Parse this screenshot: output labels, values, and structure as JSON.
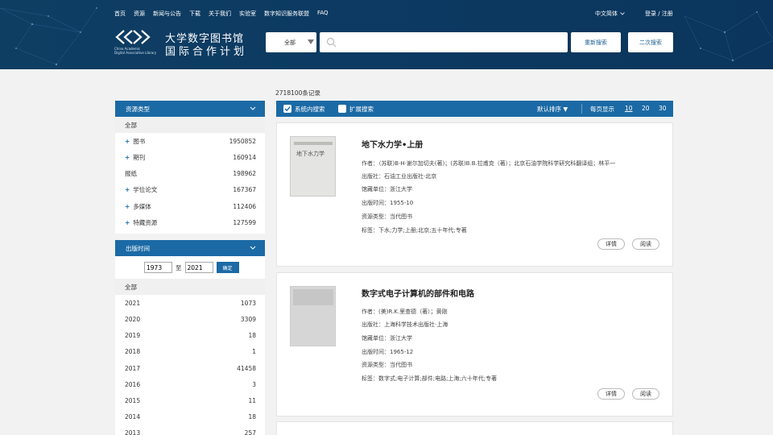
{
  "nav": [
    "首页",
    "资源",
    "新闻与公告",
    "下载",
    "关于我们",
    "实验室",
    "数字知识服务联盟",
    "FAQ"
  ],
  "lang": "中文简体",
  "login": "登录 / 注册",
  "logo": {
    "sub1": "China Academic",
    "sub2": "Digital Associative Library",
    "title1": "大学数字图书馆",
    "title2": "国际合作计划"
  },
  "search": {
    "scope": "全部",
    "placeholder": "",
    "research": "重新搜索",
    "second": "二次搜索"
  },
  "count": "2718100条记录",
  "resource": {
    "header": "资源类型",
    "all": "全部",
    "items": [
      {
        "plus": true,
        "label": "图书",
        "count": "1950852"
      },
      {
        "plus": true,
        "label": "期刊",
        "count": "160914"
      },
      {
        "plus": false,
        "label": "报纸",
        "count": "198962"
      },
      {
        "plus": true,
        "label": "学位论文",
        "count": "167367"
      },
      {
        "plus": true,
        "label": "多媒体",
        "count": "112406"
      },
      {
        "plus": true,
        "label": "特藏资源",
        "count": "127599"
      }
    ]
  },
  "pubtime": {
    "header": "出版时间",
    "from": "1973",
    "to_label": "至",
    "to": "2021",
    "ok": "确定",
    "all": "全部",
    "items": [
      {
        "label": "2021",
        "count": "1073"
      },
      {
        "label": "2020",
        "count": "3309"
      },
      {
        "label": "2019",
        "count": "18"
      },
      {
        "label": "2018",
        "count": "1"
      },
      {
        "label": "2017",
        "count": "41458"
      },
      {
        "label": "2016",
        "count": "3"
      },
      {
        "label": "2015",
        "count": "11"
      },
      {
        "label": "2014",
        "count": "18"
      },
      {
        "label": "2013",
        "count": "257"
      }
    ]
  },
  "toolbar": {
    "inside": "系统内搜索",
    "extend": "扩展搜索",
    "sort": "默认排序",
    "per_page_label": "每页显示",
    "per_page": [
      "10",
      "20",
      "30"
    ],
    "inside_checked": true,
    "extend_checked": false
  },
  "results": [
    {
      "title": "地下水力学•上册",
      "cover": "地下水力学",
      "fields": [
        "作者：（苏联)B·H·谢尔加切夫(著)；(苏联)B.B.拉甫克（著）；北京石油学院科学研究科翻译组；林平一",
        "出版社：石油工业出版社·北京",
        "馆藏单位：浙江大学",
        "出版时间：1955-10",
        "资源类型：当代图书",
        "标签：下水;力学;上册;北京;五十年代;专著"
      ],
      "detail": "详情",
      "read": "阅读"
    },
    {
      "title": "数字式电子计算机的部件和电路",
      "cover": "",
      "fields": [
        "作者：(美)R.K.里查德（著）；黄刚",
        "出版社：上海科学技术出版社·上海",
        "馆藏单位：浙江大学",
        "出版时间：1965-12",
        "资源类型：当代图书",
        "标签：数字式;电子计算;部件;电路;上海;六十年代;专著"
      ],
      "detail": "详情",
      "read": "阅读"
    }
  ]
}
